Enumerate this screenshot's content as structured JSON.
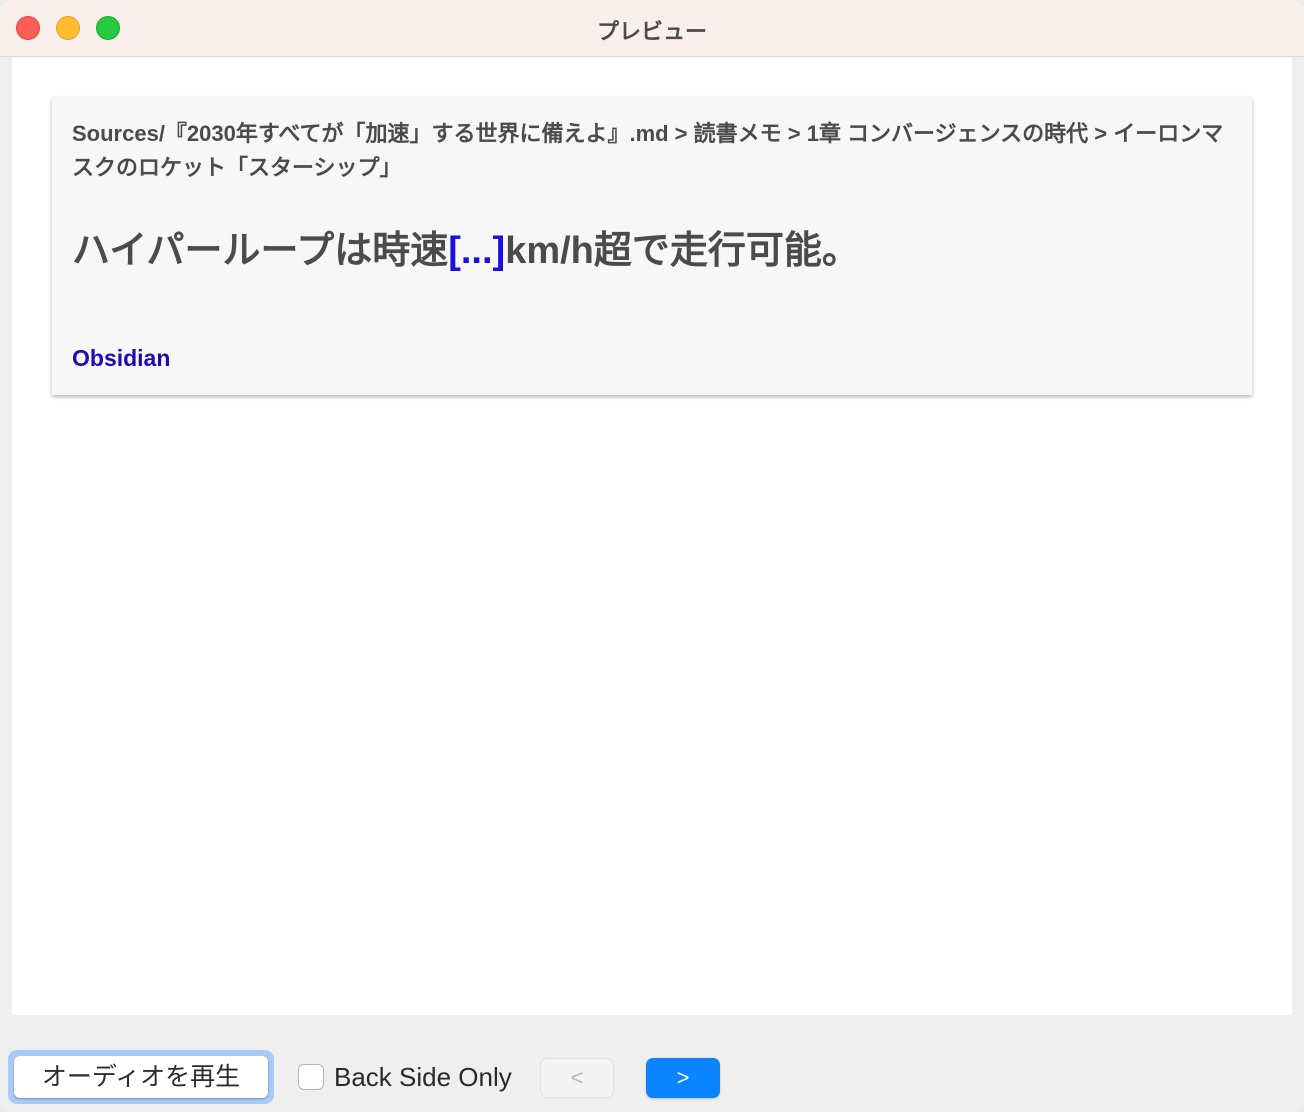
{
  "window": {
    "title": "プレビュー"
  },
  "card": {
    "breadcrumb": "Sources/『2030年すべてが「加速」する世界に備えよ』.md > 読書メモ > 1章 コンバージェンスの時代 > イーロンマスクのロケット「スターシップ」",
    "question_before": "ハイパーループは時速",
    "cloze": "[...]",
    "question_after": "km/h超で走行可能。",
    "deck_link": "Obsidian"
  },
  "controls": {
    "play_audio_label": "オーディオを再生",
    "back_side_only_label": "Back Side Only",
    "back_side_only_checked": false,
    "prev_label": "<",
    "next_label": ">"
  },
  "colors": {
    "accent": "#0a84ff",
    "cloze": "#1a0ee6",
    "deck_link": "#1d0ab5"
  }
}
